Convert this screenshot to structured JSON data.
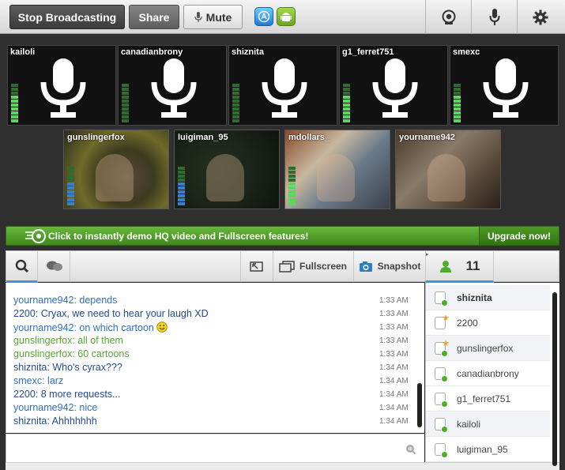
{
  "toolbar": {
    "stop_label": "Stop Broadcasting",
    "share_label": "Share",
    "mute_label": "Mute",
    "apps": [
      "ios-app-store-icon",
      "android-icon"
    ],
    "right_icons": [
      "webcam-icon",
      "microphone-icon",
      "gear-icon"
    ]
  },
  "audio_tiles": [
    {
      "name": "kailoli",
      "meter_level": 7,
      "meter_color": "green"
    },
    {
      "name": "canadianbrony",
      "meter_level": 0,
      "meter_color": "green"
    },
    {
      "name": "shiznita",
      "meter_level": 0,
      "meter_color": "green"
    },
    {
      "name": "g1_ferret751",
      "meter_level": 7,
      "meter_color": "green"
    },
    {
      "name": "smexc",
      "meter_level": 7,
      "meter_color": "green"
    }
  ],
  "video_tiles": [
    {
      "name": "gunslingerfox",
      "meter_level": 6,
      "meter_color": "blue"
    },
    {
      "name": "luigiman_95",
      "meter_level": 6,
      "meter_color": "blue"
    },
    {
      "name": "mdollars_",
      "meter_level": 6,
      "meter_color": "green"
    },
    {
      "name": "yourname942",
      "meter_level": 0,
      "meter_color": "green"
    }
  ],
  "promo": {
    "text": "Click to instantly demo HQ video and Fullscreen features!",
    "upgrade_label": "Upgrade now!"
  },
  "chat_toolbar": {
    "fullscreen_label": "Fullscreen",
    "snapshot_label": "Snapshot",
    "user_count": "11"
  },
  "messages": [
    {
      "text": "yourname942: depends",
      "time": "1:33 AM",
      "color": "blue"
    },
    {
      "text": "2200: Cryax, we need to hear your laugh XD",
      "time": "1:33 AM",
      "color": "navy"
    },
    {
      "text": "yourname942: on which cartoon",
      "time": "1:33 AM",
      "color": "blue",
      "emoji": true
    },
    {
      "text": "gunslingerfox: all of them",
      "time": "1:33 AM",
      "color": "green"
    },
    {
      "text": "gunslingerfox: 60 cartoons",
      "time": "1:33 AM",
      "color": "green"
    },
    {
      "text": "shiznita: Who's cyrax???",
      "time": "1:34 AM",
      "color": "navy"
    },
    {
      "text": "smexc: larz",
      "time": "1:34 AM",
      "color": "blue"
    },
    {
      "text": "2200: 8 more requests...",
      "time": "1:34 AM",
      "color": "navy"
    },
    {
      "text": "yourname942: nice",
      "time": "1:34 AM",
      "color": "blue"
    },
    {
      "text": "shiznita: Ahhhhhhh",
      "time": "1:34 AM",
      "color": "navy"
    }
  ],
  "users": [
    {
      "name": "shiznita",
      "bold": true,
      "status": "online",
      "alt": true
    },
    {
      "name": "2200",
      "bold": false,
      "status": "star",
      "alt": false
    },
    {
      "name": "gunslingerfox",
      "bold": false,
      "status": "star-online",
      "alt": true
    },
    {
      "name": "canadianbrony",
      "bold": false,
      "status": "online",
      "alt": false
    },
    {
      "name": "g1_ferret751",
      "bold": false,
      "status": "online",
      "alt": false
    },
    {
      "name": "kailoli",
      "bold": false,
      "status": "online",
      "alt": true
    },
    {
      "name": "luigiman_95",
      "bold": false,
      "status": "online",
      "alt": false
    }
  ]
}
